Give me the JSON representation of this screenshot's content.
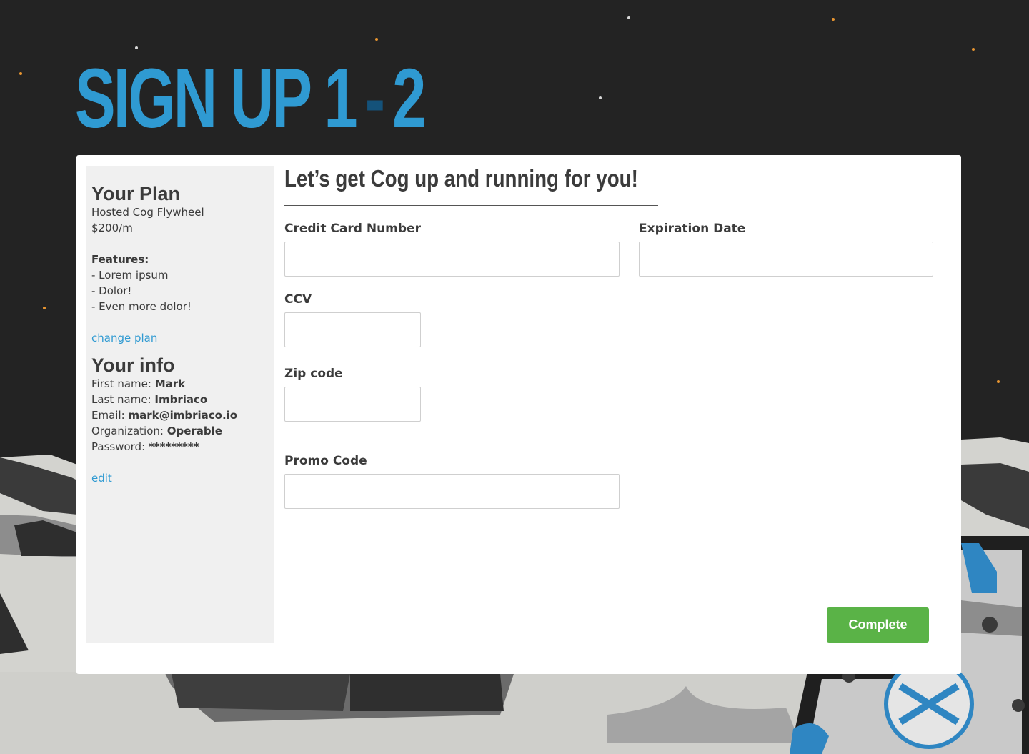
{
  "page": {
    "title_part1": "SIGN UP 1",
    "title_dash": "-",
    "title_part2": "2"
  },
  "sidebar": {
    "plan_title": "Your Plan",
    "plan_name": "Hosted Cog Flywheel",
    "plan_price": "$200/m",
    "features_label": "Features:",
    "features": [
      "- Lorem ipsum",
      "- Dolor!",
      "- Even more dolor!"
    ],
    "change_plan_link": "change plan",
    "info_title": "Your info",
    "info": [
      {
        "label": "First name:",
        "value": "Mark"
      },
      {
        "label": "Last name:",
        "value": "Imbriaco"
      },
      {
        "label": "Email:",
        "value": "mark@imbriaco.io"
      },
      {
        "label": "Organization:",
        "value": "Operable"
      },
      {
        "label": "Password:",
        "value": "*********"
      }
    ],
    "edit_link": "edit"
  },
  "form": {
    "headline": "Let’s get Cog up and running for you!",
    "fields": {
      "credit_card": {
        "label": "Credit Card Number",
        "value": ""
      },
      "expiration": {
        "label": "Expiration Date",
        "value": ""
      },
      "ccv": {
        "label": "CCV",
        "value": ""
      },
      "zip": {
        "label": "Zip code",
        "value": ""
      },
      "promo": {
        "label": "Promo Code",
        "value": ""
      }
    },
    "submit_label": "Complete"
  },
  "colors": {
    "accent_blue": "#2f9ad2",
    "title_dash": "#14527a",
    "button_green": "#5ab347",
    "background": "#232323",
    "sidebar_bg": "#f0f0f0"
  }
}
